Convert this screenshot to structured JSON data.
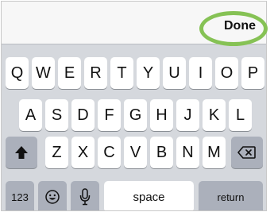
{
  "toolbar": {
    "done_label": "Done"
  },
  "keyboard": {
    "row1": [
      "Q",
      "W",
      "E",
      "R",
      "T",
      "Y",
      "U",
      "I",
      "O",
      "P"
    ],
    "row2": [
      "A",
      "S",
      "D",
      "F",
      "G",
      "H",
      "J",
      "K",
      "L"
    ],
    "row3": [
      "Z",
      "X",
      "C",
      "V",
      "B",
      "N",
      "M"
    ],
    "row4": {
      "numbers_label": "123",
      "space_label": "space",
      "return_label": "return"
    },
    "icons": {
      "shift": "shift-icon",
      "delete": "delete-icon",
      "emoji": "emoji-icon",
      "mic": "microphone-icon"
    }
  },
  "colors": {
    "highlight_ring": "#86c255",
    "key_light": "#ffffff",
    "key_dark": "#abb0bb",
    "keyboard_bg": "#d5d8dd"
  }
}
